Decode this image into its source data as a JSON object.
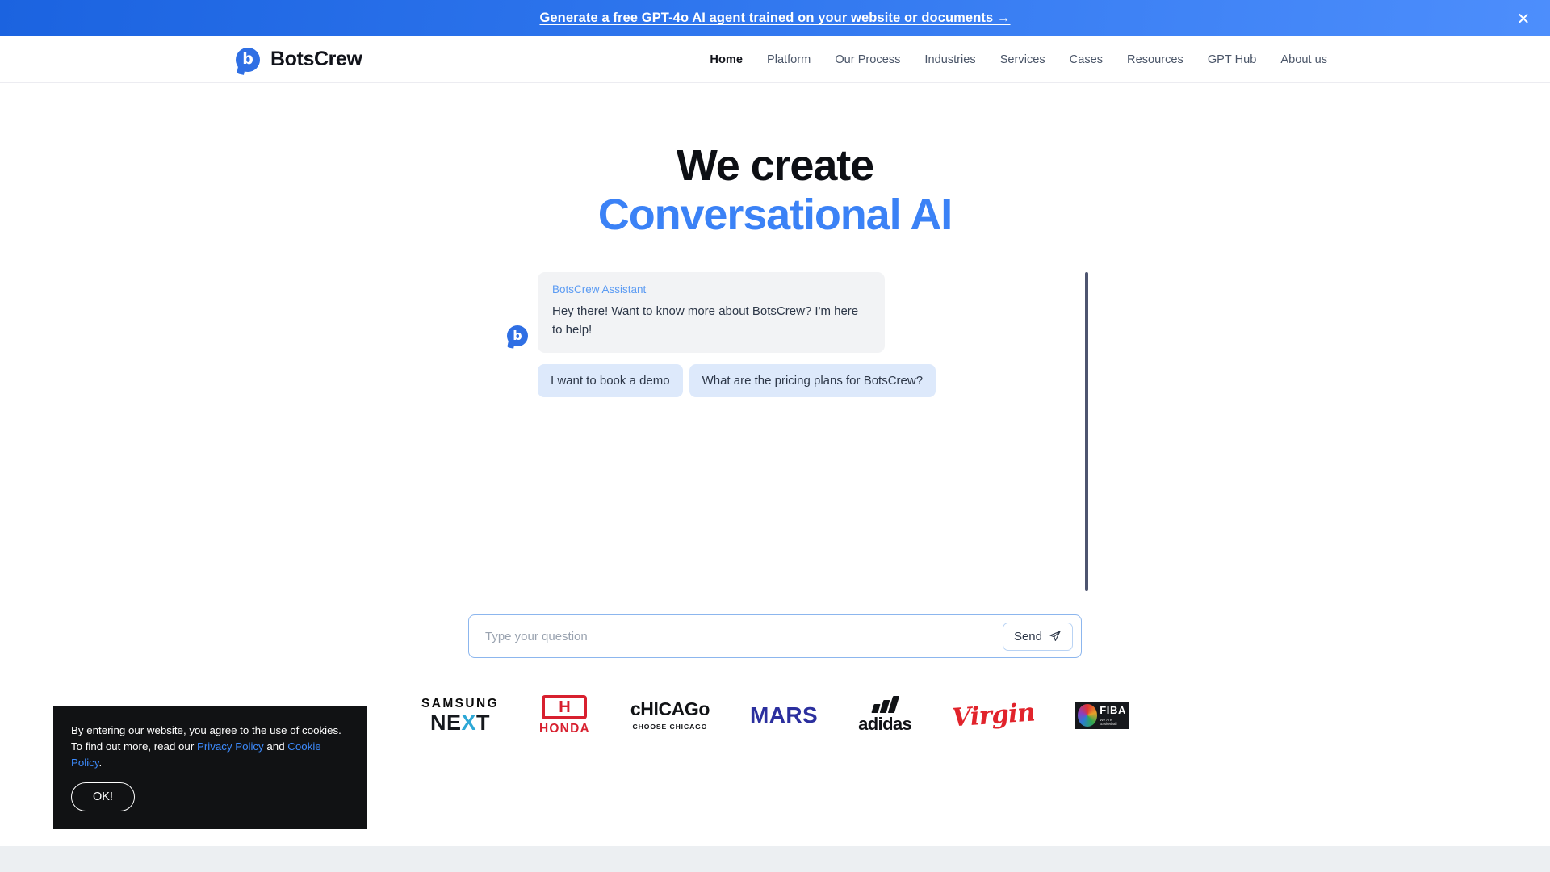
{
  "promo": {
    "text": "Generate a free GPT-4o AI agent trained on your website or documents →",
    "close_icon": "close-icon",
    "background_color": "#2f76ee"
  },
  "header": {
    "brand": {
      "mark_letter": "b",
      "name": "BotsCrew"
    },
    "nav": [
      {
        "label": "Home",
        "active": true
      },
      {
        "label": "Platform",
        "active": false
      },
      {
        "label": "Our Process",
        "active": false
      },
      {
        "label": "Industries",
        "active": false
      },
      {
        "label": "Services",
        "active": false
      },
      {
        "label": "Cases",
        "active": false
      },
      {
        "label": "Resources",
        "active": false
      },
      {
        "label": "GPT Hub",
        "active": false
      },
      {
        "label": "About us",
        "active": false
      }
    ]
  },
  "hero": {
    "line1": "We create",
    "line2": "Conversational AI",
    "accent_color": "#3b82f6"
  },
  "chat": {
    "avatar_letter": "b",
    "sender": "BotsCrew Assistant",
    "message": "Hey there! Want to know more about BotsCrew? I'm here to help!",
    "quick_replies": [
      "I want to book a demo",
      "What are the pricing plans for BotsCrew?"
    ],
    "composer": {
      "placeholder": "Type your question",
      "value": "",
      "send_label": "Send",
      "send_icon": "paper-plane-icon"
    }
  },
  "clients": {
    "samsung": {
      "top": "SAMSUNG",
      "bottom_a": "NE",
      "bottom_mark": "X",
      "bottom_b": "T"
    },
    "honda": {
      "badge": "H",
      "word": "HONDA"
    },
    "chicago": {
      "word": "cHICAGo",
      "sub": "CHOOSE CHICAGO"
    },
    "mars": {
      "word": "MARS"
    },
    "adidas": {
      "word": "adidas"
    },
    "virgin": {
      "word": "Virgin"
    },
    "fiba": {
      "word": "FIBA",
      "tagline": "We Are Basketball"
    }
  },
  "cookie": {
    "line1": "By entering our website, you agree to the use of cookies.",
    "line2_pre": "To find out more, read our ",
    "privacy_link": "Privacy Policy",
    "line2_mid": " and ",
    "cookie_link": "Cookie Policy",
    "line2_end": ".",
    "ok_label": "OK!"
  }
}
